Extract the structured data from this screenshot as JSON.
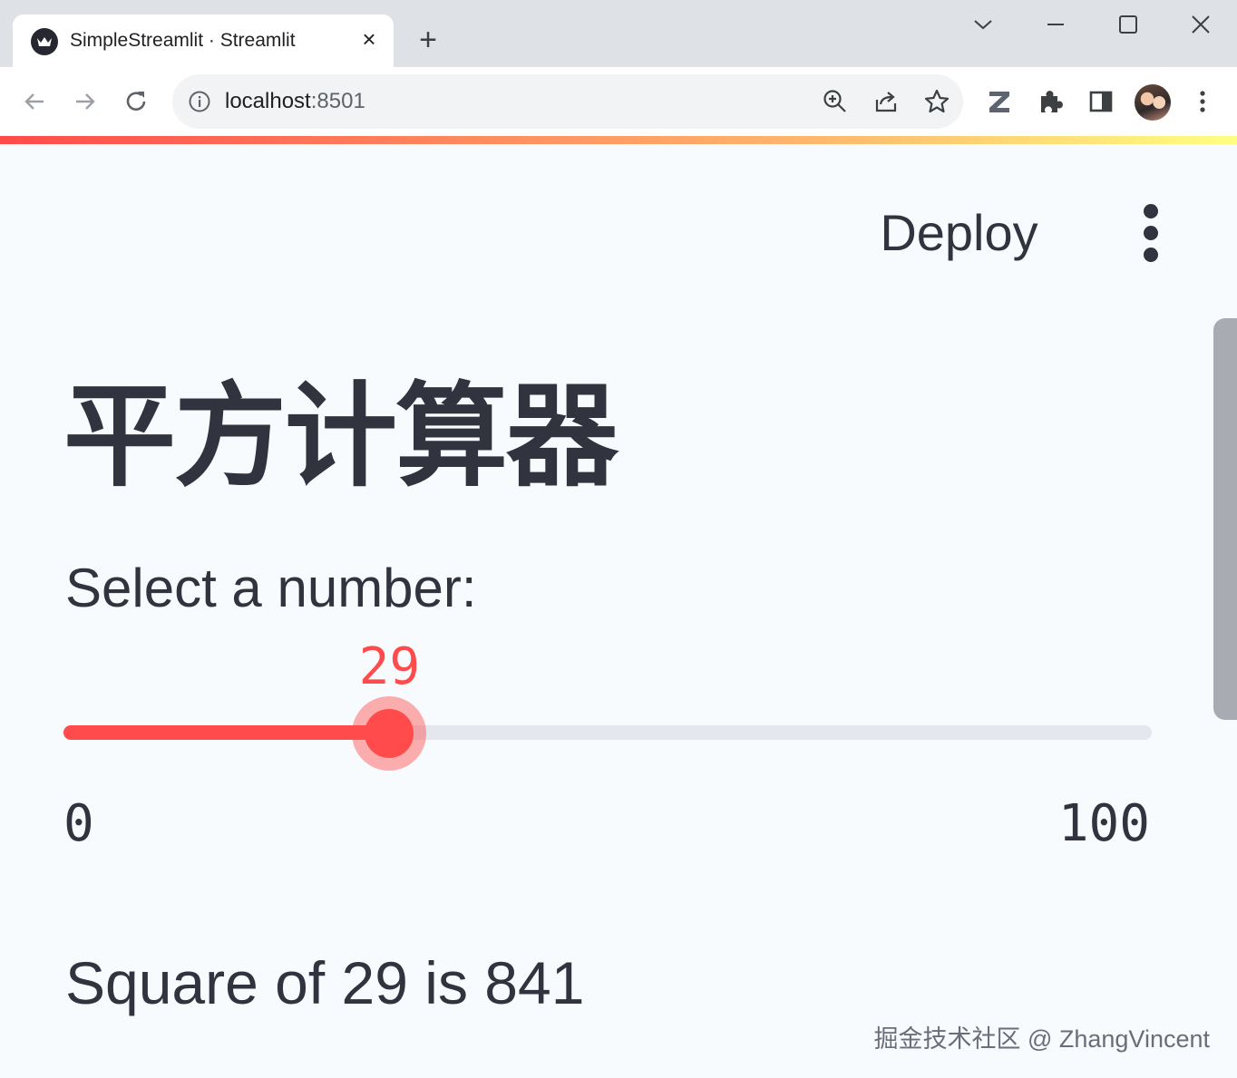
{
  "browser": {
    "tab_title": "SimpleStreamlit · Streamlit",
    "tab_close": "×",
    "new_tab": "+",
    "url_host": "localhost",
    "url_port": ":8501"
  },
  "app": {
    "deploy_label": "Deploy",
    "title": "平方计算器",
    "slider": {
      "label": "Select a number:",
      "min": 0,
      "max": 100,
      "value": 29,
      "min_label": "0",
      "max_label": "100",
      "value_label": "29",
      "accent_color": "#ff4b4b"
    },
    "result_text": "Square of 29 is 841"
  },
  "watermark": "掘金技术社区 @ ZhangVincent",
  "icons": {
    "favicon": "streamlit-crown-icon",
    "zoom": "zoom-in-icon",
    "share": "share-icon",
    "bookmark": "star-icon",
    "extension_z": "z-extension-icon",
    "extensions": "puzzle-icon",
    "sidepanel": "side-panel-icon",
    "menu": "kebab-menu-icon"
  }
}
